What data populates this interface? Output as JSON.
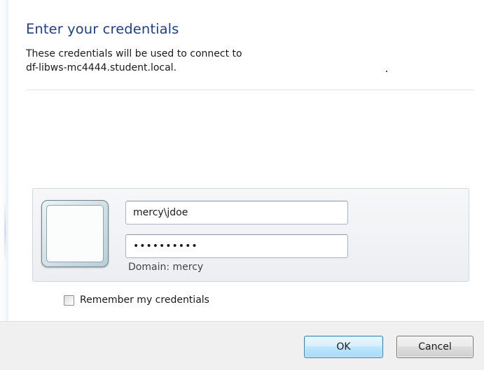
{
  "dialog": {
    "heading": "Enter your credentials",
    "description_line1": "These credentials will be used to connect to",
    "description_line2": "df-libws-mc4444.student.local."
  },
  "credentials": {
    "username_value": "mercy\\jdoe",
    "password_value": "••••••••••",
    "domain_label": "Domain: mercy"
  },
  "options": {
    "remember_label": "Remember my credentials",
    "remember_checked": false
  },
  "buttons": {
    "ok_label": "OK",
    "cancel_label": "Cancel"
  },
  "colors": {
    "heading": "#1e3f8a",
    "ok_border": "#3c7fb1",
    "footer_background": "#f0f0f0"
  },
  "icons": {
    "avatar": "user-tile-icon"
  }
}
